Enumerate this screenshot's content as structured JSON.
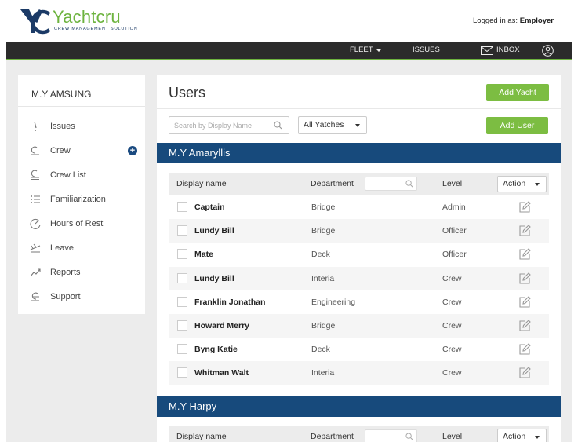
{
  "header": {
    "brand": "Yachtcru",
    "tagline": "CREW MANAGEMENT SOLUTION",
    "logged_in_prefix": "Logged in as:",
    "logged_in_user": "Employer"
  },
  "nav": {
    "fleet": "FLEET",
    "issues": "ISSUES",
    "inbox": "INBOX"
  },
  "sidebar": {
    "title": "M.Y AMSUNG",
    "items": [
      {
        "label": "Issues",
        "icon": "issues-icon"
      },
      {
        "label": "Crew",
        "icon": "crew-icon"
      },
      {
        "label": "Crew List",
        "icon": "crew-list-icon"
      },
      {
        "label": "Familiarization",
        "icon": "list-icon"
      },
      {
        "label": "Hours of Rest",
        "icon": "clock-icon"
      },
      {
        "label": "Leave",
        "icon": "plane-icon"
      },
      {
        "label": "Reports",
        "icon": "trend-icon"
      },
      {
        "label": "Support",
        "icon": "support-icon"
      }
    ]
  },
  "main": {
    "title": "Users",
    "add_yacht": "Add Yacht",
    "add_user": "Add User",
    "search_placeholder": "Search by Display Name",
    "yacht_filter": "All Yatches"
  },
  "table": {
    "col_name": "Display name",
    "col_dept": "Department",
    "col_level": "Level",
    "col_action": "Action"
  },
  "yachts": [
    {
      "name": "M.Y Amaryllis",
      "rows": [
        {
          "name": "Captain",
          "department": "Bridge",
          "level": "Admin"
        },
        {
          "name": "Lundy Bill",
          "department": "Bridge",
          "level": "Officer"
        },
        {
          "name": "Mate",
          "department": "Deck",
          "level": "Officer"
        },
        {
          "name": "Lundy Bill",
          "department": "Interia",
          "level": "Crew"
        },
        {
          "name": "Franklin Jonathan",
          "department": "Engineering",
          "level": "Crew"
        },
        {
          "name": "Howard Merry",
          "department": "Bridge",
          "level": "Crew"
        },
        {
          "name": "Byng Katie",
          "department": "Deck",
          "level": "Crew"
        },
        {
          "name": "Whitman Walt",
          "department": "Interia",
          "level": "Crew"
        }
      ]
    },
    {
      "name": "M.Y Harpy",
      "rows": []
    }
  ],
  "colors": {
    "accent_green": "#7cbd42",
    "navy": "#174a7c",
    "nav_dark": "#2b2b2b"
  }
}
